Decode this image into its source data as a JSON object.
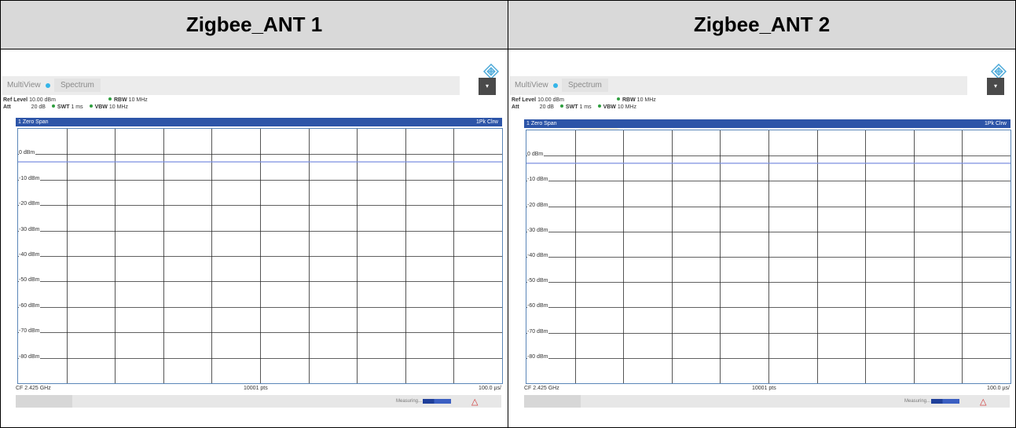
{
  "columns": [
    {
      "title": "Zigbee_ANT 1"
    },
    {
      "title": "Zigbee_ANT 2"
    }
  ],
  "analyzer": {
    "tabs": {
      "multiview": "MultiView",
      "spectrum": "Spectrum"
    },
    "params": {
      "ref_level_label": "Ref Level",
      "ref_level_value": "10.00 dBm",
      "att_label": "Att",
      "att_value": "20 dB",
      "swt_label": "SWT",
      "swt_value": "1 ms",
      "rbw_label": "RBW",
      "rbw_value": "10 MHz",
      "vbw_label": "VBW",
      "vbw_value": "10 MHz"
    },
    "trace_header": {
      "left": "1 Zero Span",
      "right": "1Pk Clrw"
    },
    "y_axis_labels": [
      "0 dBm",
      "-10 dBm",
      "-20 dBm",
      "-30 dBm",
      "-40 dBm",
      "-50 dBm",
      "-60 dBm",
      "-70 dBm",
      "-80 dBm"
    ],
    "footer": {
      "cf": "CF 2.425 GHz",
      "points": "10001 pts",
      "div": "100.0 µs/"
    },
    "status": {
      "measuring": "Measuring..."
    },
    "trace_level_dbm": -3,
    "colors": {
      "trace": "#7b8fe0",
      "header": "#2d55a8",
      "grid": "#2b2b2b"
    }
  }
}
